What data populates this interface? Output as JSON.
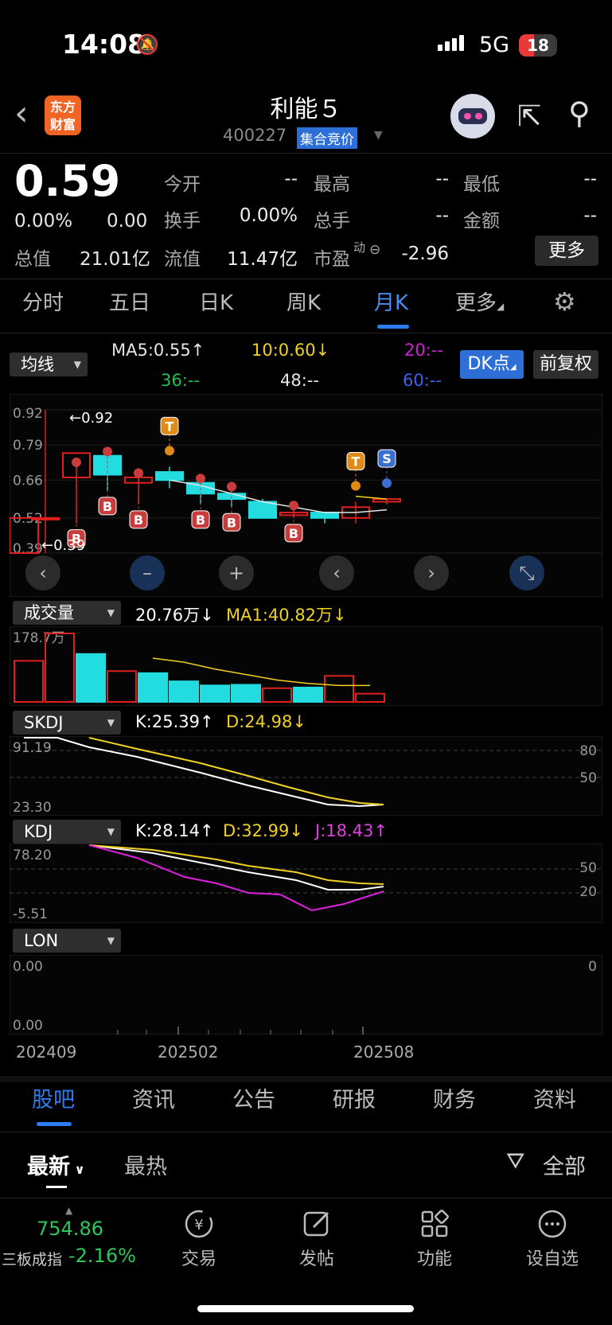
{
  "status": {
    "time": "14:08",
    "network": "5G",
    "battery": "18"
  },
  "header": {
    "back": "‹",
    "logo_line1": "东方",
    "logo_line2": "财富",
    "stock_name": "利能５",
    "stock_code": "400227",
    "trade_mode": "集合竞价"
  },
  "quote": {
    "price": "0.59",
    "change_pct": "0.00%",
    "change": "0.00",
    "open_label": "今开",
    "open": "--",
    "high_label": "最高",
    "high": "--",
    "low_label": "最低",
    "low": "--",
    "turnover_label": "换手",
    "turnover": "0.00%",
    "volume_label": "总手",
    "volume": "--",
    "amount_label": "金额",
    "amount": "--",
    "mktcap_label": "总值",
    "mktcap": "21.01亿",
    "float_label": "流值",
    "float": "11.47亿",
    "pe_label": "市盈",
    "pe_sup": "动",
    "pe": "-2.96",
    "more": "更多"
  },
  "period_tabs": [
    "分时",
    "五日",
    "日K",
    "周K",
    "月K",
    "更多"
  ],
  "active_period": "月K",
  "ma_bar": {
    "selector": "均线",
    "ma5": "MA5:0.55↑",
    "ma10": "10:0.60↓",
    "ma20": "20:--",
    "ma36": "36:--",
    "ma48": "48:--",
    "ma60": "60:--",
    "dk": "DK点",
    "adjust": "前复权"
  },
  "colors": {
    "up": "#e02020",
    "down": "#23dce0",
    "ma5": "#e6e6e6",
    "ma10": "#f0d020",
    "ma20": "#d020d0",
    "ma36": "#20c050",
    "ma60": "#4060f0",
    "accent": "#2d7cf0"
  },
  "kline": {
    "y_ticks": [
      "0.92",
      "0.79",
      "0.66",
      "0.52",
      "0.39"
    ],
    "high_marker": "←0.92",
    "low_marker": "←0.39",
    "candles": [
      {
        "o": 0.52,
        "h": 0.92,
        "l": 0.39,
        "c": 0.52,
        "up": true
      },
      {
        "o": 0.67,
        "h": 0.72,
        "l": 0.5,
        "c": 0.76,
        "up": true
      },
      {
        "o": 0.75,
        "h": 0.76,
        "l": 0.62,
        "c": 0.68,
        "up": false
      },
      {
        "o": 0.65,
        "h": 0.68,
        "l": 0.57,
        "c": 0.67,
        "up": true
      },
      {
        "o": 0.69,
        "h": 0.71,
        "l": 0.63,
        "c": 0.66,
        "up": false
      },
      {
        "o": 0.65,
        "h": 0.66,
        "l": 0.57,
        "c": 0.61,
        "up": false
      },
      {
        "o": 0.61,
        "h": 0.63,
        "l": 0.56,
        "c": 0.59,
        "up": false
      },
      {
        "o": 0.58,
        "h": 0.59,
        "l": 0.52,
        "c": 0.52,
        "up": false
      },
      {
        "o": 0.53,
        "h": 0.56,
        "l": 0.52,
        "c": 0.54,
        "up": true
      },
      {
        "o": 0.54,
        "h": 0.54,
        "l": 0.5,
        "c": 0.52,
        "up": false
      },
      {
        "o": 0.52,
        "h": 0.58,
        "l": 0.5,
        "c": 0.56,
        "up": true
      },
      {
        "o": 0.58,
        "h": 0.59,
        "l": 0.57,
        "c": 0.59,
        "up": true
      }
    ],
    "ma5": [
      0.66,
      0.64,
      0.61,
      0.58,
      0.56,
      0.54,
      0.54,
      0.55
    ],
    "ma10": [
      0.6,
      0.59
    ],
    "signals": [
      {
        "i": 1,
        "label": "B"
      },
      {
        "i": 2,
        "label": "B"
      },
      {
        "i": 3,
        "label": "B"
      },
      {
        "i": 4,
        "label": "T"
      },
      {
        "i": 5,
        "label": "B"
      },
      {
        "i": 6,
        "label": "B"
      },
      {
        "i": 8,
        "label": "B"
      },
      {
        "i": 10,
        "label": "T"
      },
      {
        "i": 11,
        "label": "S"
      }
    ]
  },
  "volume": {
    "selector": "成交量",
    "value": "20.76万↓",
    "ma1": "MA1:40.82万↓",
    "max_tick": "178.7万",
    "bars": [
      0.6,
      1.0,
      0.7,
      0.45,
      0.42,
      0.3,
      0.24,
      0.25,
      0.2,
      0.21,
      0.38,
      0.12
    ]
  },
  "skdj": {
    "selector": "SKDJ",
    "k": "K:25.39↑",
    "d": "D:24.98↓",
    "top": "91.19",
    "bottom": "23.30",
    "lvl_high": "80",
    "lvl_mid": "50"
  },
  "kdj": {
    "selector": "KDJ",
    "k": "K:28.14↑",
    "d": "D:32.99↓",
    "j": "J:18.43↑",
    "top": "78.20",
    "bottom": "-5.51",
    "lvl_high": "50",
    "lvl_low": "20"
  },
  "lon": {
    "selector": "LON",
    "top": "0.00",
    "bottom": "0.00",
    "right": "0"
  },
  "x_axis": [
    "202409",
    "202502",
    "202508"
  ],
  "bottom_tabs": [
    "股吧",
    "资讯",
    "公告",
    "研报",
    "财务",
    "资料"
  ],
  "active_bottom": "股吧",
  "filter": {
    "latest": "最新",
    "hot": "最热",
    "all": "全部"
  },
  "footer": {
    "index_value": "754.86",
    "index_name": "三板成指",
    "index_change": "-2.16%",
    "trade": "交易",
    "post": "发帖",
    "function": "功能",
    "watchlist": "设自选"
  }
}
